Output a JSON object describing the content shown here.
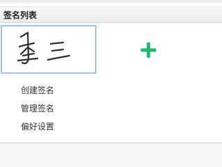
{
  "panel": {
    "title": "签名列表"
  },
  "signatures": [
    {
      "kind": "handwritten-signature-image",
      "text": "李三",
      "selected": true
    }
  ],
  "add_button": {
    "icon": "plus-icon",
    "color": "#22b573"
  },
  "menu": [
    {
      "label": "创建签名"
    },
    {
      "label": "管理签名"
    },
    {
      "label": "偏好设置"
    }
  ],
  "colors": {
    "selection_border": "#9ec3ee",
    "header_background": "#ececec"
  }
}
